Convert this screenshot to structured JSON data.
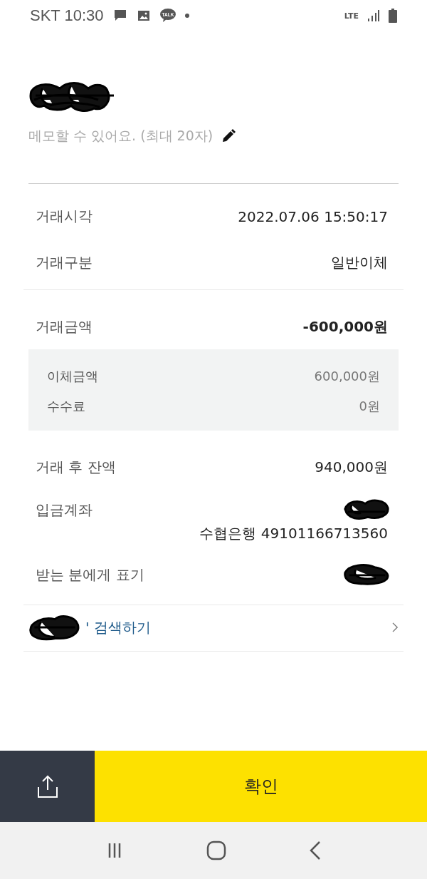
{
  "status_bar": {
    "carrier_time": "SKT 10:30",
    "chat_badge": "TALK",
    "network": "LTE"
  },
  "memo": {
    "placeholder": "메모할 수 있어요. (최대 20자)"
  },
  "details": [
    {
      "label": "거래시각",
      "value": "2022.07.06 15:50:17"
    },
    {
      "label": "거래구분",
      "value": "일반이체"
    }
  ],
  "amount": {
    "label": "거래금액",
    "value": "-600,000원"
  },
  "breakdown": [
    {
      "label": "이체금액",
      "value": "600,000원"
    },
    {
      "label": "수수료",
      "value": "0원"
    }
  ],
  "balance": {
    "label": "거래 후 잔액",
    "value": "940,000원"
  },
  "account": {
    "label": "입금계좌",
    "bank_number": "수협은행 49101166713560"
  },
  "recipient_note": {
    "label": "받는 분에게 표기"
  },
  "search_link": {
    "label": "' 검색하기"
  },
  "confirm_button": {
    "label": "확인"
  }
}
